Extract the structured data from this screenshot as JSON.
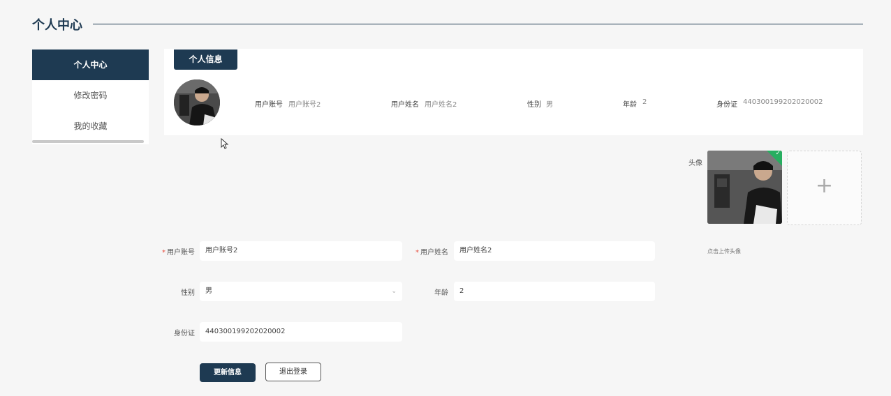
{
  "page": {
    "title": "个人中心"
  },
  "sidebar": {
    "items": [
      {
        "label": "个人中心",
        "active": true
      },
      {
        "label": "修改密码",
        "active": false
      },
      {
        "label": "我的收藏",
        "active": false
      }
    ]
  },
  "info": {
    "tab_label": "个人信息",
    "fields": [
      {
        "label": "用户账号",
        "value": "用户账号2"
      },
      {
        "label": "用户姓名",
        "value": "用户姓名2"
      },
      {
        "label": "性别",
        "value": "男"
      },
      {
        "label": "年龄",
        "value": "2"
      },
      {
        "label": "身份证",
        "value": "440300199202020002"
      }
    ]
  },
  "form": {
    "required_mark": "*",
    "account": {
      "label": "用户账号",
      "value": "用户账号2"
    },
    "name": {
      "label": "用户姓名",
      "value": "用户姓名2"
    },
    "gender": {
      "label": "性别",
      "value": "男"
    },
    "age": {
      "label": "年龄",
      "value": "2"
    },
    "id_card": {
      "label": "身份证",
      "value": "440300199202020002"
    },
    "avatar": {
      "label": "头像",
      "hint": "点击上传头像",
      "add_icon": "+"
    }
  },
  "buttons": {
    "update": "更新信息",
    "logout": "退出登录"
  },
  "colors": {
    "primary": "#1e3a52",
    "success": "#27ae60",
    "required": "#e74c3c"
  }
}
